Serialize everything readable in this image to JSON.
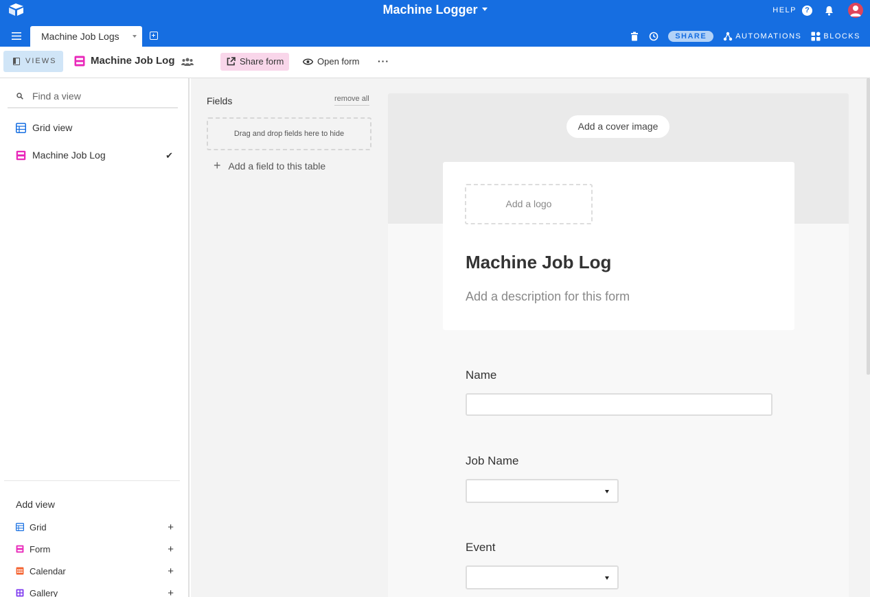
{
  "app": {
    "base_title": "Machine Logger",
    "help_label": "HELP",
    "share_label": "SHARE",
    "automations_label": "AUTOMATIONS",
    "blocks_label": "BLOCKS",
    "accent_color": "#166ee1"
  },
  "tabs": [
    {
      "label": "Machine Job Logs",
      "active": true
    }
  ],
  "viewbar": {
    "views_label": "VIEWS",
    "view_name": "Machine Job Log",
    "share_form_label": "Share form",
    "open_form_label": "Open form",
    "more_label": "···"
  },
  "sidebar": {
    "search_placeholder": "Find a view",
    "views": [
      {
        "label": "Grid view",
        "icon": "grid-icon",
        "selected": false
      },
      {
        "label": "Machine Job Log",
        "icon": "form-icon",
        "selected": true
      }
    ],
    "selected_mark": "✔",
    "add_view_title": "Add view",
    "add_view_items": [
      {
        "label": "Grid",
        "icon": "grid-icon",
        "color": "#166ee1"
      },
      {
        "label": "Form",
        "icon": "form-icon",
        "color": "#e929ba"
      },
      {
        "label": "Calendar",
        "icon": "calendar-icon",
        "color": "#f4622f"
      },
      {
        "label": "Gallery",
        "icon": "gallery-icon",
        "color": "#7c37ef"
      }
    ],
    "add_mark": "+"
  },
  "fields_panel": {
    "title": "Fields",
    "remove_all": "remove all",
    "dropzone_text": "Drag and drop fields here to hide",
    "add_field": "Add a field to this table",
    "add_mark": "+"
  },
  "form": {
    "cover_button": "Add a cover image",
    "logo_placeholder": "Add a logo",
    "title": "Machine Job Log",
    "description_placeholder": "Add a description for this form",
    "fields": [
      {
        "label": "Name",
        "type": "text",
        "value": ""
      },
      {
        "label": "Job Name",
        "type": "select",
        "value": ""
      },
      {
        "label": "Event",
        "type": "select",
        "value": ""
      }
    ]
  }
}
